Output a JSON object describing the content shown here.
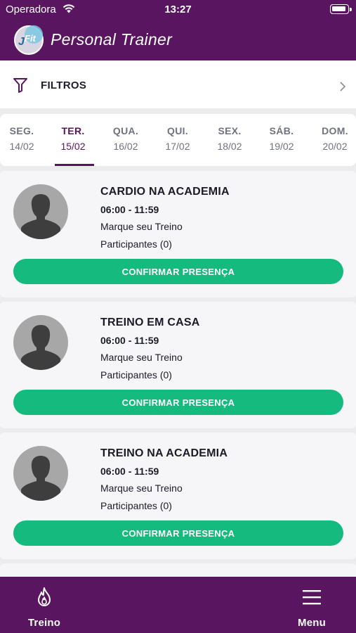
{
  "status_bar": {
    "carrier": "Operadora",
    "time": "13:27"
  },
  "header": {
    "brand_badge": "JFit",
    "brand_text": "Personal Trainer"
  },
  "filters": {
    "label": "FILTROS"
  },
  "days": [
    {
      "name": "SEG.",
      "date": "14/02",
      "active": false
    },
    {
      "name": "TER.",
      "date": "15/02",
      "active": true
    },
    {
      "name": "QUA.",
      "date": "16/02",
      "active": false
    },
    {
      "name": "QUI.",
      "date": "17/02",
      "active": false
    },
    {
      "name": "SEX.",
      "date": "18/02",
      "active": false
    },
    {
      "name": "SÁB.",
      "date": "19/02",
      "active": false
    },
    {
      "name": "DOM.",
      "date": "20/02",
      "active": false
    }
  ],
  "classes": [
    {
      "title": "CARDIO NA ACADEMIA",
      "time": "06:00 - 11:59",
      "note": "Marque seu Treino",
      "participants": "Participantes (0)",
      "button": "CONFIRMAR PRESENÇA"
    },
    {
      "title": "TREINO EM CASA",
      "time": "06:00 - 11:59",
      "note": "Marque seu Treino",
      "participants": "Participantes (0)",
      "button": "CONFIRMAR PRESENÇA"
    },
    {
      "title": "TREINO NA ACADEMIA",
      "time": "06:00 - 11:59",
      "note": "Marque seu Treino",
      "participants": "Participantes (0)",
      "button": "CONFIRMAR PRESENÇA"
    }
  ],
  "tabbar": {
    "left_label": "Treino",
    "left_icon": "flame-icon",
    "right_label": "Menu",
    "right_icon": "hamburger-menu-icon"
  },
  "colors": {
    "brand_purple": "#5a1560",
    "confirm_green": "#15bb7e",
    "avatar_gray": "#a7a7a7"
  }
}
